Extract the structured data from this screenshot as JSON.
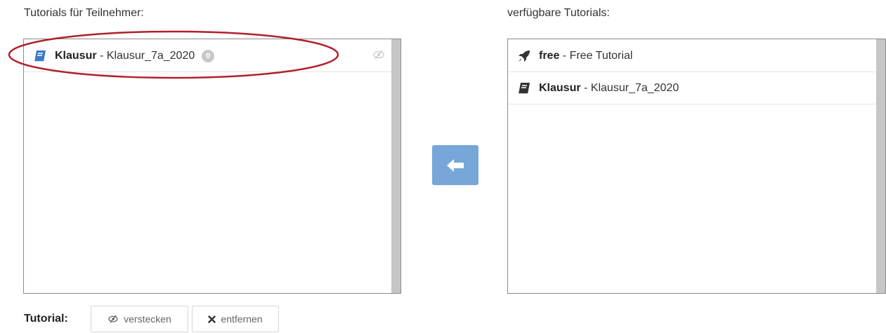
{
  "left_panel": {
    "label": "Tutorials für Teilnehmer:",
    "items": [
      {
        "name": "Klausur",
        "separator": " - ",
        "title": "Klausur_7a_2020",
        "badge": "0",
        "icon": "book-icon",
        "hidden_icon": "eye-slash-icon"
      }
    ]
  },
  "right_panel": {
    "label": "verfügbare Tutorials:",
    "items": [
      {
        "name": "free",
        "separator": " - ",
        "title": "Free Tutorial",
        "icon": "rocket-icon"
      },
      {
        "name": "Klausur",
        "separator": " - ",
        "title": "Klausur_7a_2020",
        "icon": "book-icon"
      }
    ]
  },
  "move_button": {
    "icon": "arrow-left-icon",
    "color": "#76a7d8"
  },
  "footer": {
    "label": "Tutorial:",
    "hide_button": "verstecken",
    "remove_button": "entfernen"
  },
  "colors": {
    "accent": "#76a7d8",
    "annotation": "#b0202a",
    "book_icon_left": "#3a7bc8"
  }
}
